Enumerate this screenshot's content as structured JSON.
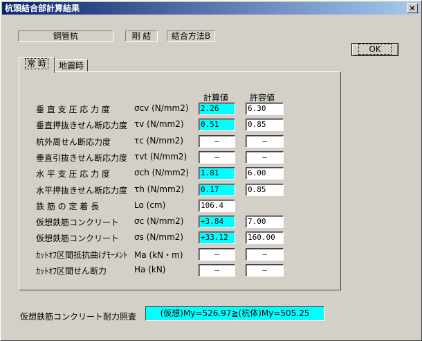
{
  "window": {
    "title": "杭頭結合部計算結果",
    "close_label": "×"
  },
  "header": {
    "pile_type": "鋼管杭",
    "joint": "剛 結",
    "method": "結合方法B"
  },
  "ok_label": "OK",
  "tabs": [
    {
      "label": "常 時"
    },
    {
      "label": "地震時"
    }
  ],
  "columns": {
    "calc": "計算値",
    "allow": "許容値"
  },
  "rows": [
    {
      "label": "垂 直 支 圧 応 力 度",
      "symbol": "σcv (N/mm2)",
      "calc": "2.26",
      "allow": "6.30"
    },
    {
      "label": "垂直押抜きせん断応力度",
      "symbol": "τv (N/mm2)",
      "calc": "0.51",
      "allow": "0.85"
    },
    {
      "label": "杭外周せん断応力度",
      "symbol": "τc (N/mm2)",
      "calc": "—",
      "allow": "—"
    },
    {
      "label": "垂直引抜きせん断応力度",
      "symbol": "τvt (N/mm2)",
      "calc": "—",
      "allow": "—"
    },
    {
      "label": "水 平 支 圧 応 力 度",
      "symbol": "σch (N/mm2)",
      "calc": "1.81",
      "allow": "6.00"
    },
    {
      "label": "水平押抜きせん断応力度",
      "symbol": "τh (N/mm2)",
      "calc": "0.17",
      "allow": "0.85"
    },
    {
      "label": "鉄 筋 の 定 着 長",
      "symbol": "Lo (cm)",
      "calc": "106.4",
      "allow": ""
    },
    {
      "label": "仮想鉄筋コンクリート",
      "symbol": "σc (N/mm2)",
      "calc": "+3.84",
      "allow": "7.00"
    },
    {
      "label": "仮想鉄筋コンクリート",
      "symbol": "σs (N/mm2)",
      "calc": "+33.12",
      "allow": "160.00"
    },
    {
      "label": "ｶｯﾄｵﾌ区間抵抗曲げﾓｰﾒﾝﾄ",
      "symbol": "Ma (kN・m)",
      "calc": "—",
      "allow": "—"
    },
    {
      "label": "ｶｯﾄｵﾌ区間せん断力",
      "symbol": "Ha (kN)",
      "calc": "—",
      "allow": "—"
    }
  ],
  "result": {
    "label": "仮想鉄筋コンクリート耐力照査",
    "value": "(仮想)My=526.97≧(杭体)My=505.25"
  },
  "colors": {
    "highlight": "#00ffff",
    "titlebar": "#0a246a",
    "face": "#d4d0c8"
  }
}
